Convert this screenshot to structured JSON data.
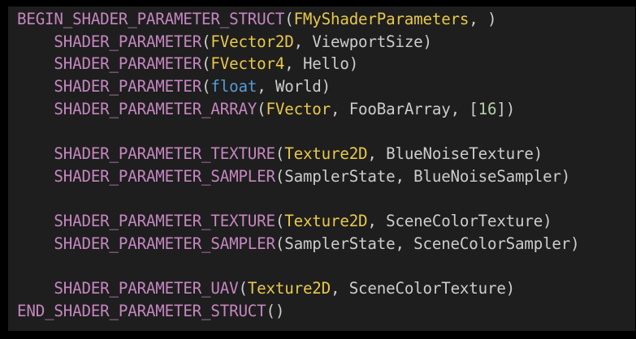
{
  "colors": {
    "background": "#1e1e1e",
    "border": "#000000",
    "macro": "#c586c0",
    "type": "#e8c84a",
    "keyword": "#569cd6",
    "number": "#b5cea8",
    "default": "#cccccc"
  },
  "code": {
    "lines": [
      [
        {
          "t": "BEGIN_SHADER_PARAMETER_STRUCT",
          "k": "macro"
        },
        {
          "t": "(",
          "k": "punct"
        },
        {
          "t": "FMyShaderParameters",
          "k": "type"
        },
        {
          "t": ", )",
          "k": "punct"
        }
      ],
      [
        {
          "t": "    ",
          "k": "punct"
        },
        {
          "t": "SHADER_PARAMETER",
          "k": "macro"
        },
        {
          "t": "(",
          "k": "punct"
        },
        {
          "t": "FVector2D",
          "k": "type"
        },
        {
          "t": ", ViewportSize)",
          "k": "ident"
        }
      ],
      [
        {
          "t": "    ",
          "k": "punct"
        },
        {
          "t": "SHADER_PARAMETER",
          "k": "macro"
        },
        {
          "t": "(",
          "k": "punct"
        },
        {
          "t": "FVector4",
          "k": "type"
        },
        {
          "t": ", Hello)",
          "k": "ident"
        }
      ],
      [
        {
          "t": "    ",
          "k": "punct"
        },
        {
          "t": "SHADER_PARAMETER",
          "k": "macro"
        },
        {
          "t": "(",
          "k": "punct"
        },
        {
          "t": "float",
          "k": "keyword"
        },
        {
          "t": ", World)",
          "k": "ident"
        }
      ],
      [
        {
          "t": "    ",
          "k": "punct"
        },
        {
          "t": "SHADER_PARAMETER_ARRAY",
          "k": "macro"
        },
        {
          "t": "(",
          "k": "punct"
        },
        {
          "t": "FVector",
          "k": "type"
        },
        {
          "t": ", FooBarArray, [",
          "k": "ident"
        },
        {
          "t": "16",
          "k": "number"
        },
        {
          "t": "])",
          "k": "punct"
        }
      ],
      [],
      [
        {
          "t": "    ",
          "k": "punct"
        },
        {
          "t": "SHADER_PARAMETER_TEXTURE",
          "k": "macro"
        },
        {
          "t": "(",
          "k": "punct"
        },
        {
          "t": "Texture2D",
          "k": "type"
        },
        {
          "t": ", BlueNoiseTexture)",
          "k": "ident"
        }
      ],
      [
        {
          "t": "    ",
          "k": "punct"
        },
        {
          "t": "SHADER_PARAMETER_SAMPLER",
          "k": "macro"
        },
        {
          "t": "(SamplerState, BlueNoiseSampler)",
          "k": "ident"
        }
      ],
      [],
      [
        {
          "t": "    ",
          "k": "punct"
        },
        {
          "t": "SHADER_PARAMETER_TEXTURE",
          "k": "macro"
        },
        {
          "t": "(",
          "k": "punct"
        },
        {
          "t": "Texture2D",
          "k": "type"
        },
        {
          "t": ", SceneColorTexture)",
          "k": "ident"
        }
      ],
      [
        {
          "t": "    ",
          "k": "punct"
        },
        {
          "t": "SHADER_PARAMETER_SAMPLER",
          "k": "macro"
        },
        {
          "t": "(SamplerState, SceneColorSampler)",
          "k": "ident"
        }
      ],
      [],
      [
        {
          "t": "    ",
          "k": "punct"
        },
        {
          "t": "SHADER_PARAMETER_UAV",
          "k": "macro"
        },
        {
          "t": "(",
          "k": "punct"
        },
        {
          "t": "Texture2D",
          "k": "type"
        },
        {
          "t": ", SceneColorTexture)",
          "k": "ident"
        }
      ],
      [
        {
          "t": "END_SHADER_PARAMETER_STRUCT",
          "k": "macro"
        },
        {
          "t": "()",
          "k": "punct"
        }
      ]
    ]
  }
}
